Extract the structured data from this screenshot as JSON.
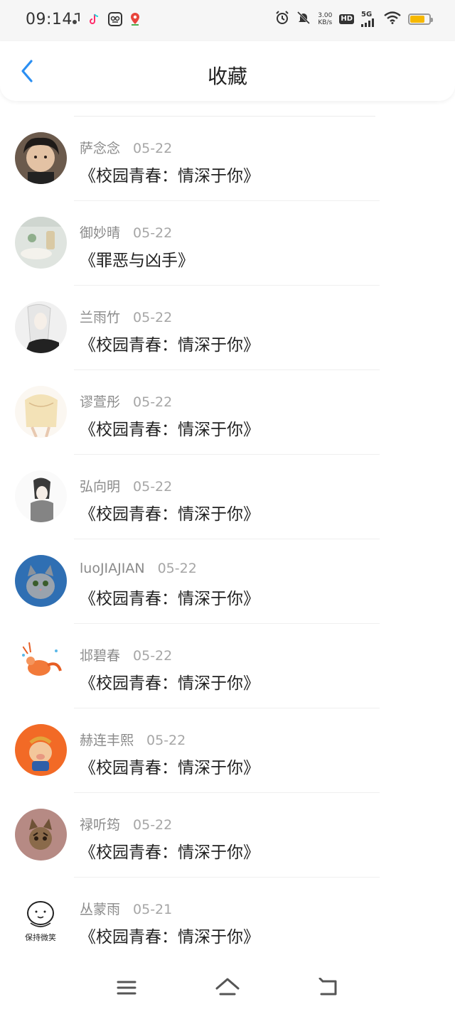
{
  "status_bar": {
    "time": "09:14",
    "net_speed_value": "3.00",
    "net_speed_unit": "KB/s",
    "hd_label": "HD",
    "network_label": "5G",
    "battery_level": 0.75,
    "battery_color": "#f6b800",
    "icons": [
      "music-note-icon",
      "tiktok-icon",
      "app-icon",
      "map-pin-icon",
      "alarm-icon",
      "mute-icon",
      "signal-icon",
      "wifi-icon",
      "battery-icon"
    ]
  },
  "header": {
    "title": "收藏",
    "back_icon": "chevron-left-icon",
    "accent_color": "#2b8ff2"
  },
  "favorites": [
    {
      "user": "萨念念",
      "date": "05-22",
      "title": "《校园青春：情深于你》",
      "avatar": "man-portrait"
    },
    {
      "user": "御妙晴",
      "date": "05-22",
      "title": "《罪恶与凶手》",
      "avatar": "tea-cup-photo"
    },
    {
      "user": "兰雨竹",
      "date": "05-22",
      "title": "《校园青春：情深于你》",
      "avatar": "white-hair-figure"
    },
    {
      "user": "谬萱彤",
      "date": "05-22",
      "title": "《校园青春：情深于你》",
      "avatar": "anime-girl-dress"
    },
    {
      "user": "弘向明",
      "date": "05-22",
      "title": "《校园青春：情深于你》",
      "avatar": "sketch-boy"
    },
    {
      "user": "luoJIAJIAN",
      "date": "05-22",
      "title": "《校园青春：情深于你》",
      "avatar": "kitten-photo"
    },
    {
      "user": "邶碧春",
      "date": "05-22",
      "title": "《校园青春：情深于你》",
      "avatar": "cartoon-shrimp"
    },
    {
      "user": "赫连丰熙",
      "date": "05-22",
      "title": "《校园青春：情深于你》",
      "avatar": "cartoon-pig-orange"
    },
    {
      "user": "禄听筠",
      "date": "05-22",
      "title": "《校园青春：情深于你》",
      "avatar": "tabby-cat"
    },
    {
      "user": "丛蒙雨",
      "date": "05-21",
      "title": "《校园青春：情深于你》",
      "avatar": "keep-smiling-doodle",
      "avatar_caption": "保持微笑"
    }
  ],
  "bottom_nav": {
    "icons": [
      "menu-icon",
      "home-icon",
      "back-icon"
    ]
  }
}
